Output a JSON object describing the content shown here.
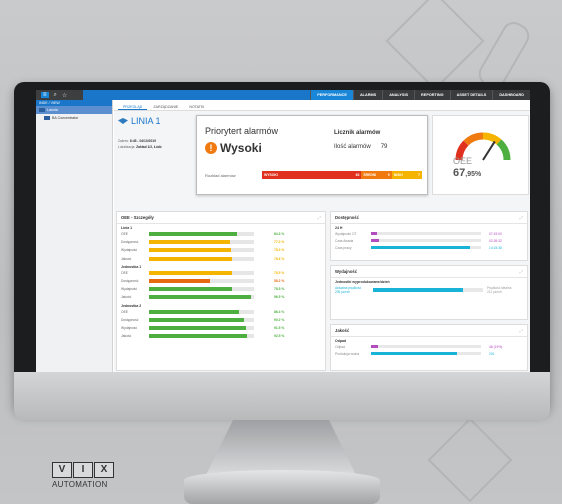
{
  "topbar": {
    "icons": [
      "menu-icon",
      "search-icon",
      "star-icon"
    ],
    "menu": [
      {
        "label": "PERFORMANCE",
        "active": true
      },
      {
        "label": "ALARMS",
        "active": false
      },
      {
        "label": "ANALYSIS",
        "active": false
      },
      {
        "label": "REPORTING",
        "active": false
      },
      {
        "label": "ASSET DETAILS",
        "active": false
      },
      {
        "label": "DASHBOARD",
        "active": false
      }
    ]
  },
  "sidebar": {
    "header": "INDE / VIEW",
    "items": [
      {
        "label": "Lasota",
        "selected": true
      },
      {
        "label": "BA Concentrator",
        "selected": false
      }
    ]
  },
  "tabs": [
    {
      "label": "PRZEGLĄD",
      "active": true
    },
    {
      "label": "ZARZĄDZANIE",
      "active": false
    },
    {
      "label": "NOTATKI",
      "active": false
    }
  ],
  "line": {
    "title": "LINIA 1",
    "zakres_label": "Zakres:",
    "zakres_value": "8:45 - 04/10/2019",
    "lokalizacja_label": "Lokalizacja:",
    "lokalizacja_value": "Zakład 1/2, Łódź"
  },
  "alarm": {
    "priority_title": "Priorytert alarmów",
    "priority_value": "Wysoki",
    "counter_title": "Licznik alarmów",
    "count_label": "Ilość alarmów",
    "count_value": "79",
    "dist_label": "Rozkład alarmów",
    "bars": [
      {
        "label": "WYSOKI",
        "value": "63",
        "color": "#e0301e"
      },
      {
        "label": "ŚREDNI",
        "value": "9",
        "color": "#f07a10"
      },
      {
        "label": "NISKI",
        "value": "7",
        "color": "#f5b400"
      }
    ]
  },
  "oee": {
    "label": "OEE",
    "value_int": "67",
    "value_dec": ",95%",
    "gauge_level": 0.68
  },
  "details": {
    "title": "OEE - Szczegóły",
    "groups": [
      {
        "name": "Linia 1",
        "rows": [
          {
            "label": "OEE",
            "value": "84.3 %",
            "fill": 0.84,
            "color": "#4caf3f"
          },
          {
            "label": "Dostępność",
            "value": "77.0 %",
            "fill": 0.77,
            "color": "#f5b400"
          },
          {
            "label": "Wydajność",
            "value": "78.0 %",
            "fill": 0.78,
            "color": "#f5b400"
          },
          {
            "label": "Jakość",
            "value": "78.6 %",
            "fill": 0.79,
            "color": "#f5b400"
          }
        ]
      },
      {
        "name": "Jednostka 1",
        "rows": [
          {
            "label": "OEE",
            "value": "78.5 %",
            "fill": 0.79,
            "color": "#f5b400"
          },
          {
            "label": "Dostępność",
            "value": "58.2 %",
            "fill": 0.58,
            "color": "#e86a10"
          },
          {
            "label": "Wydajność",
            "value": "78.5 %",
            "fill": 0.79,
            "color": "#4caf3f"
          },
          {
            "label": "Jakość",
            "value": "96.5 %",
            "fill": 0.97,
            "color": "#4caf3f"
          }
        ]
      },
      {
        "name": "Jednostka 2",
        "rows": [
          {
            "label": "OEE",
            "value": "86.4 %",
            "fill": 0.86,
            "color": "#4caf3f"
          },
          {
            "label": "Dostępność",
            "value": "90.2 %",
            "fill": 0.9,
            "color": "#4caf3f"
          },
          {
            "label": "Wydajność",
            "value": "91.5 %",
            "fill": 0.92,
            "color": "#4caf3f"
          },
          {
            "label": "Jakość",
            "value": "92.5 %",
            "fill": 0.93,
            "color": "#4caf3f"
          }
        ]
      }
    ]
  },
  "availability": {
    "title": "Dostępność",
    "sub": "24 H",
    "lines": [
      {
        "label": "Wydajność OT",
        "value": "07:19:00",
        "fill": 0.05,
        "color": "#b24dbf"
      },
      {
        "label": "Czas Awaria",
        "value": "02:26:32",
        "fill": 0.07,
        "color": "#b24dbf"
      },
      {
        "label": "Czas pracy",
        "value": "14:15:38",
        "fill": 0.9,
        "color": "#19b3d8"
      }
    ]
  },
  "performance": {
    "title": "Wydajność",
    "sub": "Jednostki wyprodukowane/dzień",
    "actual_label": "Aktualna prędkość",
    "actual_value": "205 pz/rzh",
    "ideal_label": "Prędkość idealna",
    "ideal_value": "211 pz/rzh",
    "fill": 0.82
  },
  "quality": {
    "title": "Jakość",
    "sub": "Odpad",
    "lines": [
      {
        "label": "Odpad",
        "value": "48 (19%)",
        "fill": 0.06,
        "color": "#b24dbf"
      },
      {
        "label": "Produkcja wolna",
        "value": "201",
        "fill": 0.78,
        "color": "#19b3d8"
      }
    ]
  },
  "brand": {
    "mark": [
      "V",
      "I",
      "X"
    ],
    "word": "AUTOMATION"
  }
}
